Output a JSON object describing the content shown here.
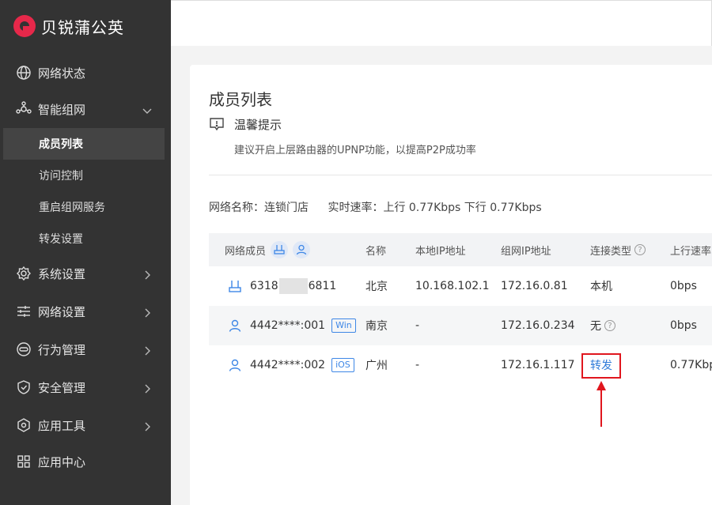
{
  "brand": {
    "name": "贝锐蒲公英",
    "color": "#e6284a"
  },
  "sidebar": {
    "items": [
      {
        "label": "网络状态",
        "icon": "globe-icon"
      },
      {
        "label": "智能组网",
        "icon": "network-icon",
        "expanded": true
      },
      {
        "label": "系统设置",
        "icon": "gear-icon"
      },
      {
        "label": "网络设置",
        "icon": "sliders-icon"
      },
      {
        "label": "行为管理",
        "icon": "behavior-icon"
      },
      {
        "label": "安全管理",
        "icon": "shield-icon"
      },
      {
        "label": "应用工具",
        "icon": "tools-icon"
      },
      {
        "label": "应用中心",
        "icon": "apps-icon"
      }
    ],
    "sub_items": [
      {
        "label": "成员列表",
        "active": true
      },
      {
        "label": "访问控制"
      },
      {
        "label": "重启组网服务"
      },
      {
        "label": "转发设置"
      }
    ]
  },
  "page": {
    "title": "成员列表",
    "tip_title": "温馨提示",
    "tip_text": "建议开启上层路由器的UPNP功能，以提高P2P成功率",
    "network_name_label": "网络名称：",
    "network_name": "连锁门店",
    "speed_label": "实时速率：",
    "speed_value": "上行 0.77Kbps 下行 0.77Kbps"
  },
  "table": {
    "headers": {
      "member": "网络成员",
      "name": "名称",
      "local_ip": "本地IP地址",
      "vpn_ip": "组网IP地址",
      "conn_type": "连接类型",
      "upload": "上行速率"
    },
    "rows": [
      {
        "id_prefix": "6318",
        "id_suffix": "6811",
        "tag": "",
        "device": "router-icon",
        "name": "北京",
        "local_ip": "10.168.102.1",
        "vpn_ip": "172.16.0.81",
        "conn": "本机",
        "upload": "0bps"
      },
      {
        "id_prefix": "4442****:001",
        "id_suffix": "",
        "tag": "Win",
        "device": "user-icon",
        "name": "南京",
        "local_ip": "-",
        "vpn_ip": "172.16.0.234",
        "conn": "无",
        "upload": "0bps"
      },
      {
        "id_prefix": "4442****:002",
        "id_suffix": "",
        "tag": "iOS",
        "device": "user-icon",
        "name": "广州",
        "local_ip": "-",
        "vpn_ip": "172.16.1.117",
        "conn": "转发",
        "upload": "0.77Kbp"
      }
    ]
  },
  "colors": {
    "sidebar_bg": "#333333",
    "accent_blue": "#2f7bd8",
    "highlight_red": "#e0161e"
  }
}
